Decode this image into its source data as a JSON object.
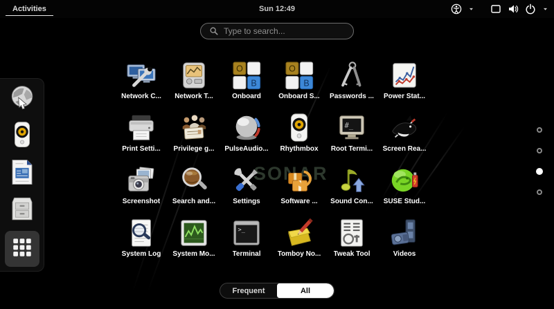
{
  "topbar": {
    "activities_label": "Activities",
    "clock": "Sun 12:49",
    "status_icons": [
      "accessibility-icon",
      "caret-down-icon",
      "display-icon",
      "volume-icon",
      "power-icon",
      "caret-down-icon"
    ]
  },
  "search": {
    "placeholder": "Type to search..."
  },
  "wallpaper": {
    "watermark": "SONAR"
  },
  "dock": {
    "items": [
      {
        "id": "web-browser",
        "icon": "web-browser-icon",
        "active": false
      },
      {
        "id": "rhythmbox",
        "icon": "rhythmbox-icon",
        "active": false
      },
      {
        "id": "document-writer",
        "icon": "document-writer-icon",
        "active": false
      },
      {
        "id": "file-cabinet",
        "icon": "file-cabinet-icon",
        "active": false
      },
      {
        "id": "show-applications",
        "icon": "show-apps-grid-icon",
        "active": true
      }
    ]
  },
  "app_grid": {
    "apps": [
      {
        "id": "network-connections",
        "label": "Network C...",
        "icon": "network-connections-icon"
      },
      {
        "id": "network-tools",
        "label": "Network T...",
        "icon": "network-tools-icon"
      },
      {
        "id": "onboard",
        "label": "Onboard",
        "icon": "onboard-icon"
      },
      {
        "id": "onboard-settings",
        "label": "Onboard S...",
        "icon": "onboard-icon"
      },
      {
        "id": "passwords-keys",
        "label": "Passwords ...",
        "icon": "passwords-keys-icon"
      },
      {
        "id": "power-statistics",
        "label": "Power Stat...",
        "icon": "power-statistics-icon"
      },
      {
        "id": "print-settings",
        "label": "Print Setti...",
        "icon": "printer-icon"
      },
      {
        "id": "privilege-granting",
        "label": "Privilege g...",
        "icon": "privilege-granting-icon"
      },
      {
        "id": "pulseaudio",
        "label": "PulseAudio...",
        "icon": "pulseaudio-icon"
      },
      {
        "id": "rhythmbox",
        "label": "Rhythmbox",
        "icon": "rhythmbox-icon"
      },
      {
        "id": "root-terminal",
        "label": "Root Termi...",
        "icon": "root-terminal-icon"
      },
      {
        "id": "screen-reader",
        "label": "Screen Rea...",
        "icon": "screen-reader-icon"
      },
      {
        "id": "screenshot",
        "label": "Screenshot",
        "icon": "screenshot-icon"
      },
      {
        "id": "search-files",
        "label": "Search and...",
        "icon": "search-files-icon"
      },
      {
        "id": "settings",
        "label": "Settings",
        "icon": "settings-icon"
      },
      {
        "id": "software",
        "label": "Software ...",
        "icon": "software-icon"
      },
      {
        "id": "sound-converter",
        "label": "Sound Con...",
        "icon": "sound-converter-icon"
      },
      {
        "id": "suse-studio",
        "label": "SUSE Stud...",
        "icon": "suse-studio-icon"
      },
      {
        "id": "system-log",
        "label": "System Log",
        "icon": "system-log-icon"
      },
      {
        "id": "system-monitor",
        "label": "System Mo...",
        "icon": "system-monitor-icon"
      },
      {
        "id": "terminal",
        "label": "Terminal",
        "icon": "terminal-icon"
      },
      {
        "id": "tomboy-notes",
        "label": "Tomboy No...",
        "icon": "tomboy-notes-icon"
      },
      {
        "id": "tweak-tool",
        "label": "Tweak Tool",
        "icon": "tweak-tool-icon"
      },
      {
        "id": "videos",
        "label": "Videos",
        "icon": "videos-icon"
      }
    ]
  },
  "page_indicator": {
    "count": 4,
    "active_index": 2
  },
  "view_tabs": {
    "frequent_label": "Frequent",
    "all_label": "All",
    "selected": "All"
  },
  "colors": {
    "background": "#000000",
    "topbar": "#040404",
    "selected_tab_bg": "#ffffff",
    "label_text": "#ffffff"
  }
}
